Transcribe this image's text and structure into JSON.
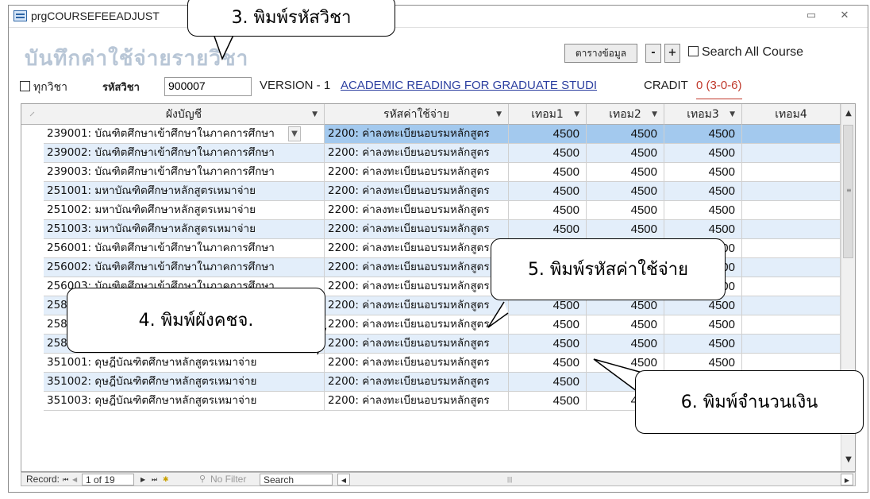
{
  "window": {
    "title": "prgCOURSEFEEADJUST",
    "minimize_glyph": "▭",
    "close_glyph": "✕"
  },
  "form": {
    "title": "บันทึกค่าใช้จ่ายรายวิชา",
    "table_button": "ตารางข้อมูล",
    "minus_button": "-",
    "plus_button": "+",
    "search_all_label": "Search All Course",
    "all_subjects_label": "ทุกวิชา",
    "course_code_label": "รหัสวิชา",
    "course_code_value": "900007",
    "version_text": "VERSION - 1",
    "course_name": "ACADEMIC READING FOR GRADUATE STUDI",
    "credit_label": "CRADIT",
    "credit_value": "0 (3-0-6)"
  },
  "grid": {
    "columns": [
      {
        "label": "ผังบัญชี"
      },
      {
        "label": "รหัสค่าใช้จ่าย"
      },
      {
        "label": "เทอม1"
      },
      {
        "label": "เทอม2"
      },
      {
        "label": "เทอม3"
      },
      {
        "label": "เทอม4"
      }
    ],
    "rows": [
      {
        "account": "239001: บัณฑิตศึกษาเข้าศึกษาในภาคการศึกษา",
        "expense": "2200: ค่าลงทะเบียนอบรมหลักสูตร",
        "t1": "4500",
        "t2": "4500",
        "t3": "4500",
        "t4": ""
      },
      {
        "account": "239002: บัณฑิตศึกษาเข้าศึกษาในภาคการศึกษา",
        "expense": "2200: ค่าลงทะเบียนอบรมหลักสูตร",
        "t1": "4500",
        "t2": "4500",
        "t3": "4500",
        "t4": ""
      },
      {
        "account": "239003: บัณฑิตศึกษาเข้าศึกษาในภาคการศึกษา",
        "expense": "2200: ค่าลงทะเบียนอบรมหลักสูตร",
        "t1": "4500",
        "t2": "4500",
        "t3": "4500",
        "t4": ""
      },
      {
        "account": "251001: มหาบัณฑิตศึกษาหลักสูตรเหมาจ่าย",
        "expense": "2200: ค่าลงทะเบียนอบรมหลักสูตร",
        "t1": "4500",
        "t2": "4500",
        "t3": "4500",
        "t4": ""
      },
      {
        "account": "251002: มหาบัณฑิตศึกษาหลักสูตรเหมาจ่าย",
        "expense": "2200: ค่าลงทะเบียนอบรมหลักสูตร",
        "t1": "4500",
        "t2": "4500",
        "t3": "4500",
        "t4": ""
      },
      {
        "account": "251003: มหาบัณฑิตศึกษาหลักสูตรเหมาจ่าย",
        "expense": "2200: ค่าลงทะเบียนอบรมหลักสูตร",
        "t1": "4500",
        "t2": "4500",
        "t3": "4500",
        "t4": ""
      },
      {
        "account": "256001: บัณฑิตศึกษาเข้าศึกษาในภาคการศึกษา",
        "expense": "2200: ค่าลงทะเบียนอบรมหลักสูตร",
        "t1": "4500",
        "t2": "4500",
        "t3": "4500",
        "t4": ""
      },
      {
        "account": "256002: บัณฑิตศึกษาเข้าศึกษาในภาคการศึกษา",
        "expense": "2200: ค่าลงทะเบียนอบรมหลักสูตร",
        "t1": "4500",
        "t2": "4500",
        "t3": "4500",
        "t4": ""
      },
      {
        "account": "256003: บัณฑิตศึกษาเข้าศึกษาในภาคการศึกษา",
        "expense": "2200: ค่าลงทะเบียนอบรมหลักสูตร",
        "t1": "4500",
        "t2": "4500",
        "t3": "4500",
        "t4": ""
      },
      {
        "account": "258001: บัณฑิตศึกษาเข้าศึกษาในภาคการศึกษา",
        "expense": "2200: ค่าลงทะเบียนอบรมหลักสูตร",
        "t1": "4500",
        "t2": "4500",
        "t3": "4500",
        "t4": ""
      },
      {
        "account": "258002: บัณฑิตศึกษาเข้าศึกษาในภาคการศึกษา",
        "expense": "2200: ค่าลงทะเบียนอบรมหลักสูตร",
        "t1": "4500",
        "t2": "4500",
        "t3": "4500",
        "t4": ""
      },
      {
        "account": "258003: บัณฑิตศึกษาเข้าศึกษาในภาคการศึกษา",
        "expense": "2200: ค่าลงทะเบียนอบรมหลักสูตร",
        "t1": "4500",
        "t2": "4500",
        "t3": "4500",
        "t4": ""
      },
      {
        "account": "351001: ดุษฎีบัณฑิตศึกษาหลักสูตรเหมาจ่าย",
        "expense": "2200: ค่าลงทะเบียนอบรมหลักสูตร",
        "t1": "4500",
        "t2": "4500",
        "t3": "4500",
        "t4": ""
      },
      {
        "account": "351002: ดุษฎีบัณฑิตศึกษาหลักสูตรเหมาจ่าย",
        "expense": "2200: ค่าลงทะเบียนอบรมหลักสูตร",
        "t1": "4500",
        "t2": "4500",
        "t3": "4500",
        "t4": ""
      },
      {
        "account": "351003: ดุษฎีบัณฑิตศึกษาหลักสูตรเหมาจ่าย",
        "expense": "2200: ค่าลงทะเบียนอบรมหลักสูตร",
        "t1": "4500",
        "t2": "4500",
        "t3": "4500",
        "t4": ""
      }
    ]
  },
  "navbar": {
    "record_label": "Record:",
    "position": "1 of 19",
    "filter_text": "No Filter",
    "search_text": "Search"
  },
  "annotations": [
    "3.  พิมพ์รหัสวิชา",
    "4.  พิมพ์ผังคชจ.",
    "5.  พิมพ์รหัสค่าใช้จ่าย",
    "6.  พิมพ์จำนวนเงิน"
  ],
  "colors": {
    "selected_row": "#a3c9ee",
    "alt_row": "#e3eefa",
    "link_blue": "#2c3fa0",
    "credit_red": "#c0392b",
    "title_faded": "#b8c6d6"
  },
  "icons": [
    "app-form-icon",
    "minimize-icon",
    "close-icon",
    "dropdown-icon",
    "scroll-up-icon",
    "scroll-down-icon",
    "nav-first-icon",
    "nav-prev-icon",
    "nav-next-icon",
    "nav-last-icon",
    "nav-new-icon",
    "filter-icon"
  ]
}
